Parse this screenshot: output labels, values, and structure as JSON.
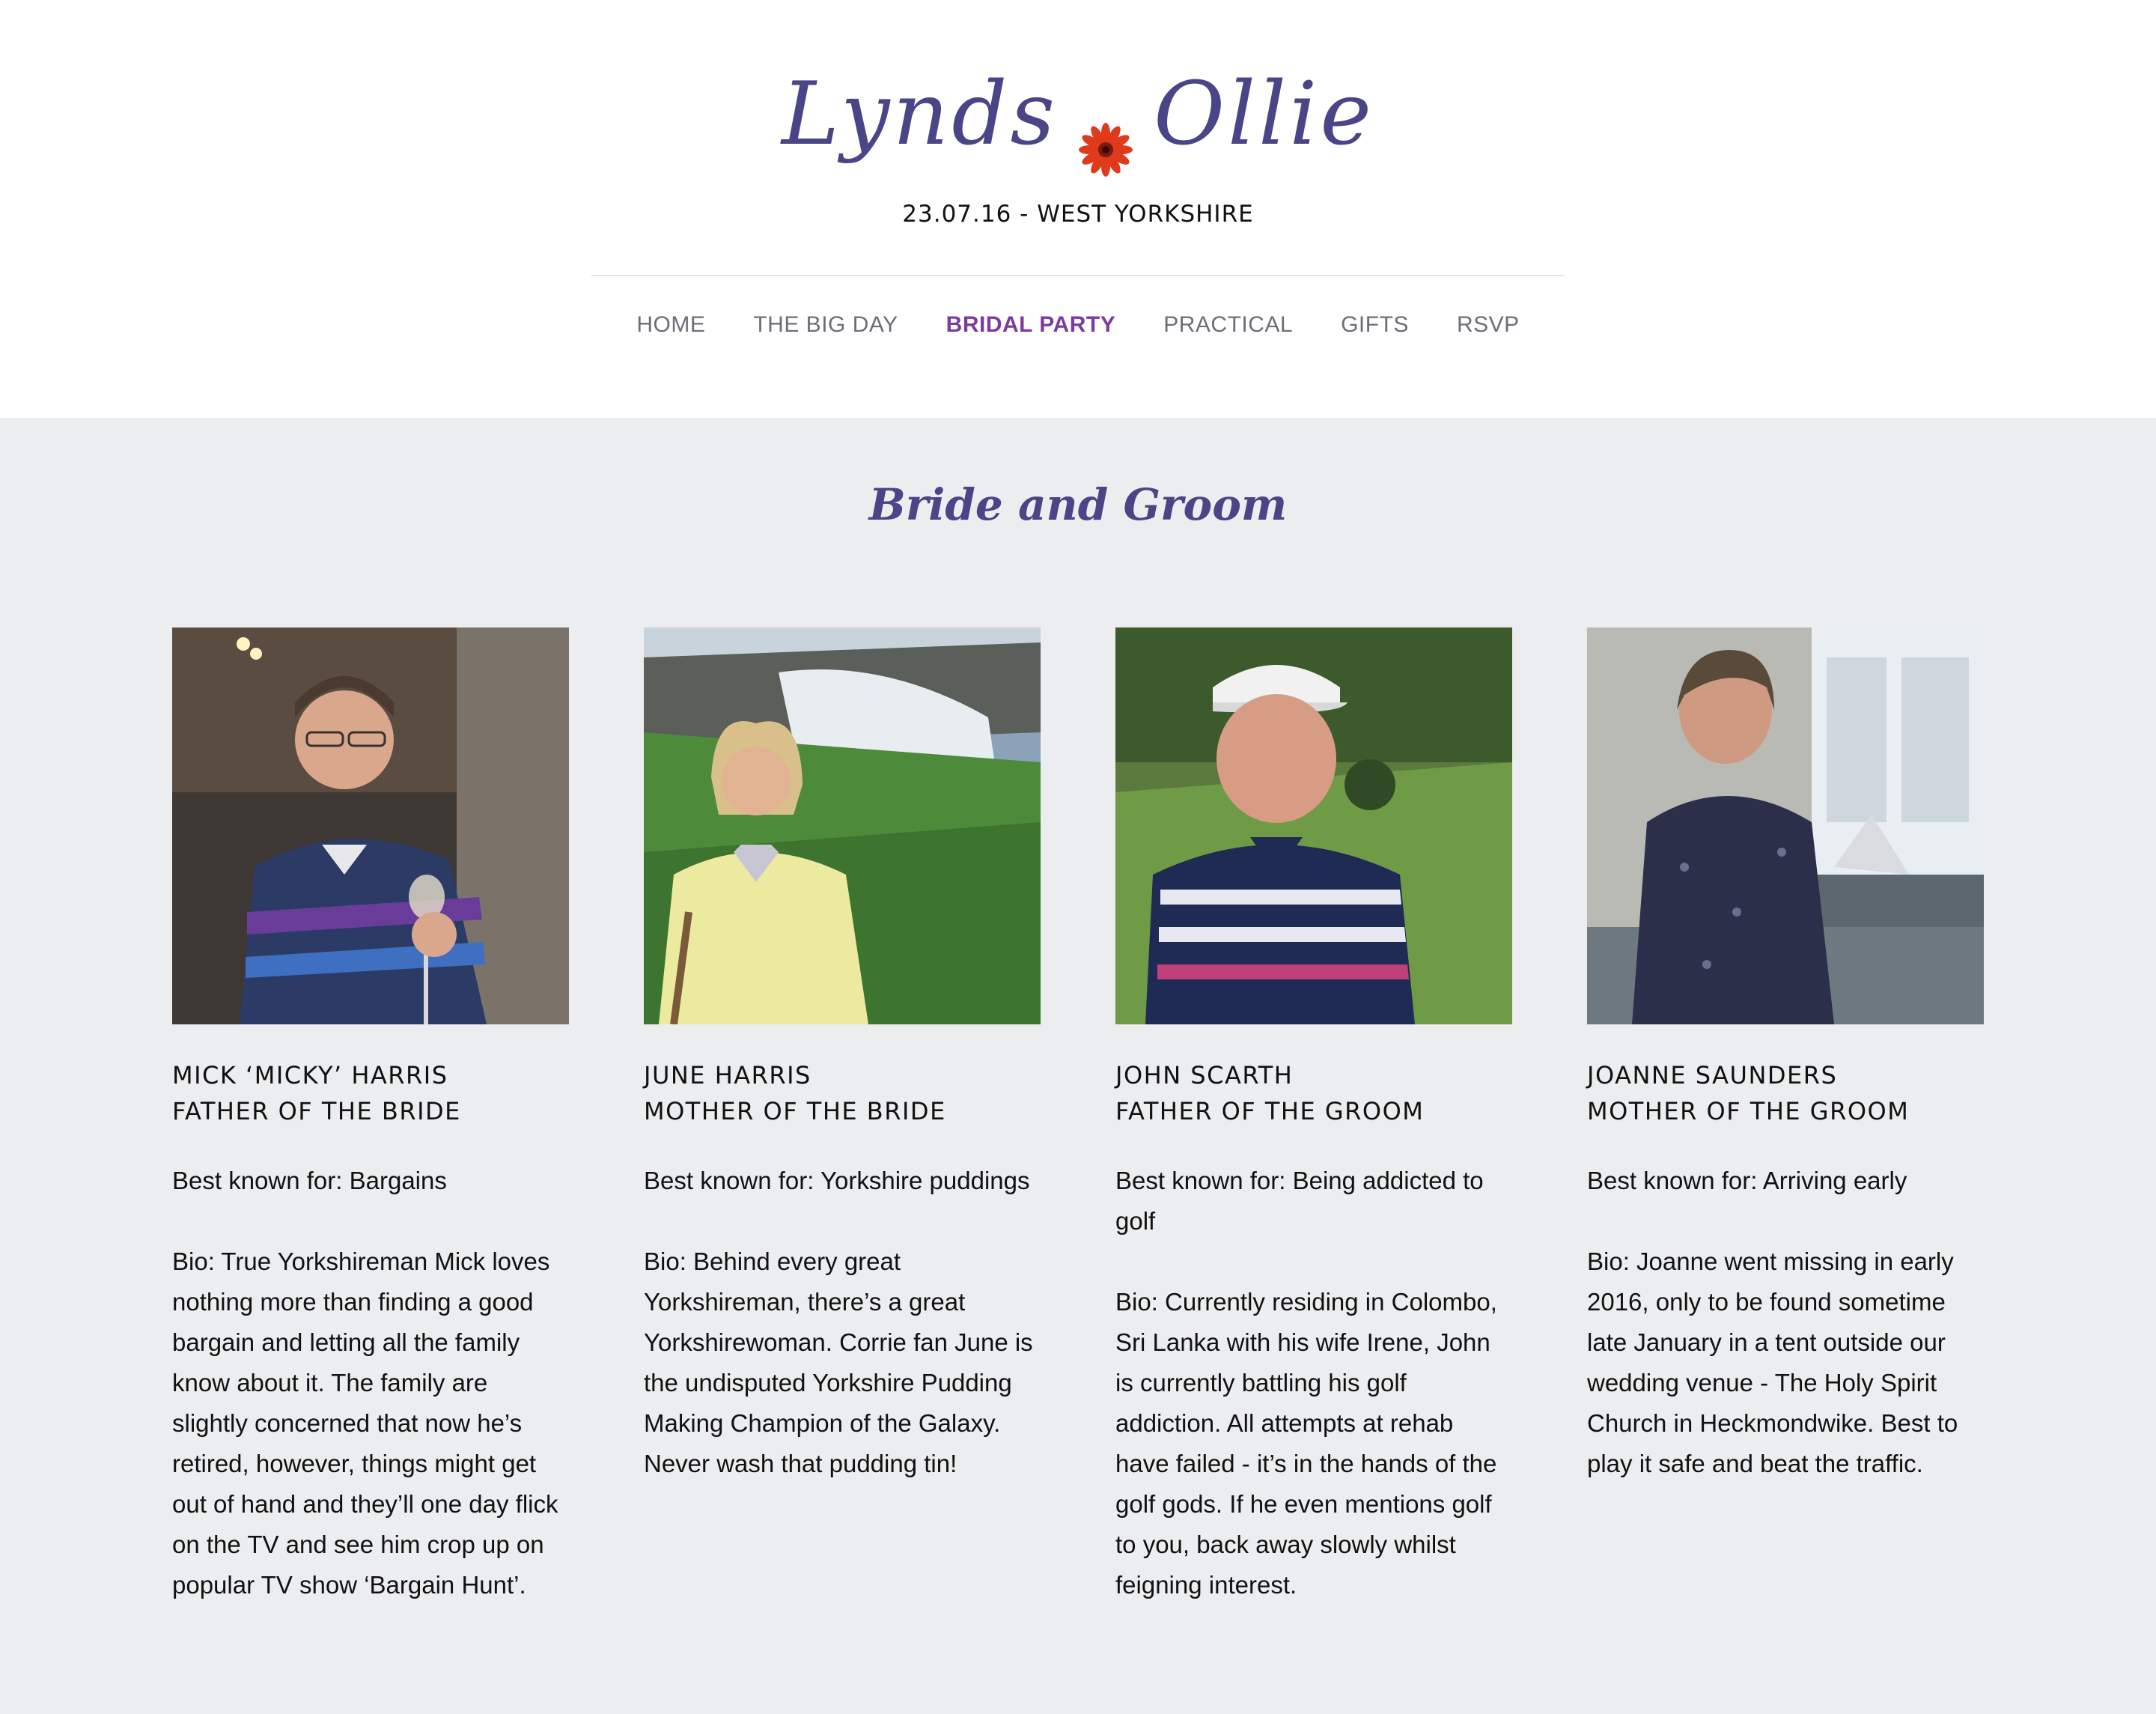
{
  "site": {
    "logo_left": "Lynds",
    "logo_right": "Ollie",
    "date_location": "23.07.16 - WEST YORKSHIRE"
  },
  "nav": {
    "items": [
      {
        "label": "HOME",
        "active": false
      },
      {
        "label": "THE BIG DAY",
        "active": false
      },
      {
        "label": "BRIDAL PARTY",
        "active": true
      },
      {
        "label": "PRACTICAL",
        "active": false
      },
      {
        "label": "GIFTS",
        "active": false
      },
      {
        "label": "RSVP",
        "active": false
      }
    ]
  },
  "section": {
    "title": "Bride and Groom"
  },
  "people": [
    {
      "name": "MICK ‘MICKY’ HARRIS",
      "role": "FATHER OF THE BRIDE",
      "known": "Best known for: Bargains",
      "bio": "Bio: True Yorkshireman Mick loves nothing more than finding a good bargain and letting all the family know about it. The family are slightly concerned that now he’s retired, however, things might get out of hand and they’ll one day flick on the TV and see him crop up on popular TV show ‘Bargain Hunt’."
    },
    {
      "name": "JUNE HARRIS",
      "role": "MOTHER OF THE BRIDE",
      "known": "Best known for: Yorkshire puddings",
      "bio": "Bio: Behind every great Yorkshireman, there’s a great Yorkshirewoman. Corrie fan June is the undisputed Yorkshire Pudding Making Champion of the Galaxy. Never wash that pudding tin!"
    },
    {
      "name": "JOHN SCARTH",
      "role": "FATHER OF THE GROOM",
      "known": "Best known for: Being addicted to golf",
      "bio": "Bio: Currently residing in Colombo, Sri Lanka with his wife Irene, John is currently battling his golf addiction. All attempts at rehab have failed - it’s in the hands of the golf gods. If he even mentions golf to you, back away slowly whilst feigning interest."
    },
    {
      "name": "JOANNE SAUNDERS",
      "role": "MOTHER OF THE GROOM",
      "known": "Best known for: Arriving early",
      "bio": "Bio: Joanne went missing in early 2016, only to be found sometime late January in a tent outside our wedding venue - The Holy Spirit Church in Heckmondwike. Best to play it safe and beat the traffic."
    }
  ],
  "colors": {
    "brand": "#4a4586",
    "active_nav": "#7c3ba0",
    "nav": "#6d6d78",
    "flower": "#e03a1c",
    "page_bg": "#ecedef"
  },
  "icons": {
    "logo_flower": "gerbera-flower-icon"
  }
}
